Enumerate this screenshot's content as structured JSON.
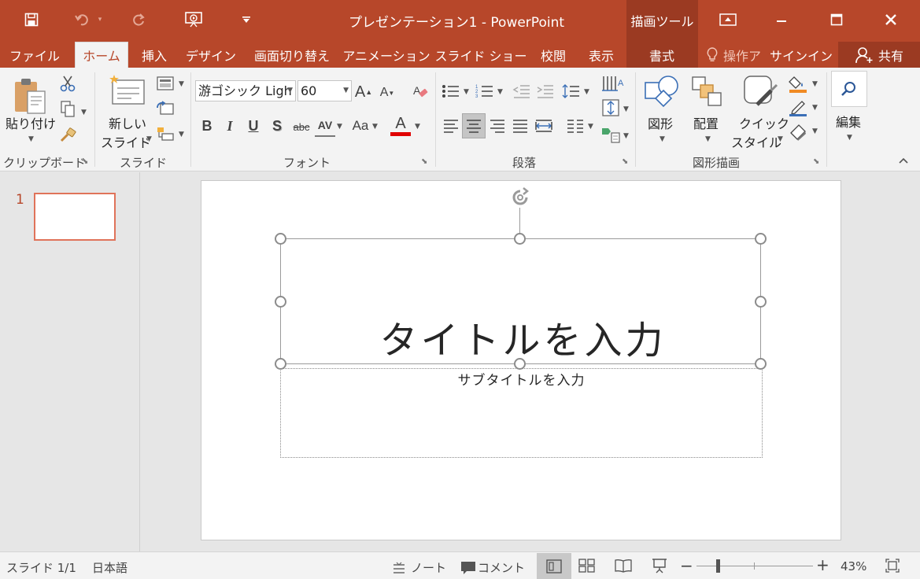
{
  "window": {
    "title": "プレゼンテーション1 - PowerPoint",
    "context_tool_label": "描画ツール",
    "controls": {
      "restore_ribbon": "restore-ribbon-icon",
      "minimize": "minimize-icon",
      "maximize": "maximize-icon",
      "close": "close-icon"
    }
  },
  "quick_access": [
    "save-icon",
    "undo-icon",
    "redo-icon",
    "present-icon",
    "customize-icon"
  ],
  "tabs": [
    {
      "label": "ファイル"
    },
    {
      "label": "ホーム"
    },
    {
      "label": "挿入"
    },
    {
      "label": "デザイン"
    },
    {
      "label": "画面切り替え"
    },
    {
      "label": "アニメーション"
    },
    {
      "label": "スライド ショー"
    },
    {
      "label": "校閲"
    },
    {
      "label": "表示"
    },
    {
      "label": "書式"
    }
  ],
  "tell_me": "操作ア",
  "signin": "サインイン",
  "share": "共有",
  "ribbon": {
    "clipboard": {
      "paste_label": "貼り付け",
      "group_label": "クリップボード"
    },
    "slides": {
      "new_slide_line1": "新しい",
      "new_slide_line2": "スライド",
      "group_label": "スライド"
    },
    "font": {
      "font_name": "游ゴシック Ligh",
      "font_size": "60",
      "group_label": "フォント",
      "bold": "B",
      "italic": "I",
      "underline": "U",
      "shadow": "S",
      "strike": "abc",
      "spacing": "AV",
      "case": "Aa",
      "color": "A",
      "grow": "A",
      "shrink": "A"
    },
    "paragraph": {
      "group_label": "段落"
    },
    "drawing": {
      "shapes_label": "図形",
      "arrange_label": "配置",
      "quick_style_line1": "クイック",
      "quick_style_line2": "スタイル",
      "group_label": "図形描画"
    },
    "editing": {
      "label": "編集"
    }
  },
  "thumbnails": [
    {
      "number": "1"
    }
  ],
  "slide": {
    "title_placeholder": "タイトルを入力",
    "subtitle_placeholder": "サブタイトルを入力"
  },
  "status": {
    "slide_indicator": "スライド 1/1",
    "language": "日本語",
    "notes": "ノート",
    "comments": "コメント",
    "zoom_percent": "43%",
    "zoom_level": 0.43
  },
  "colors": {
    "accent": "#b7472a",
    "ribbon_bg": "#f3f3f3",
    "thumb_border": "#e0735a",
    "font_color_bar": "#e00000"
  }
}
